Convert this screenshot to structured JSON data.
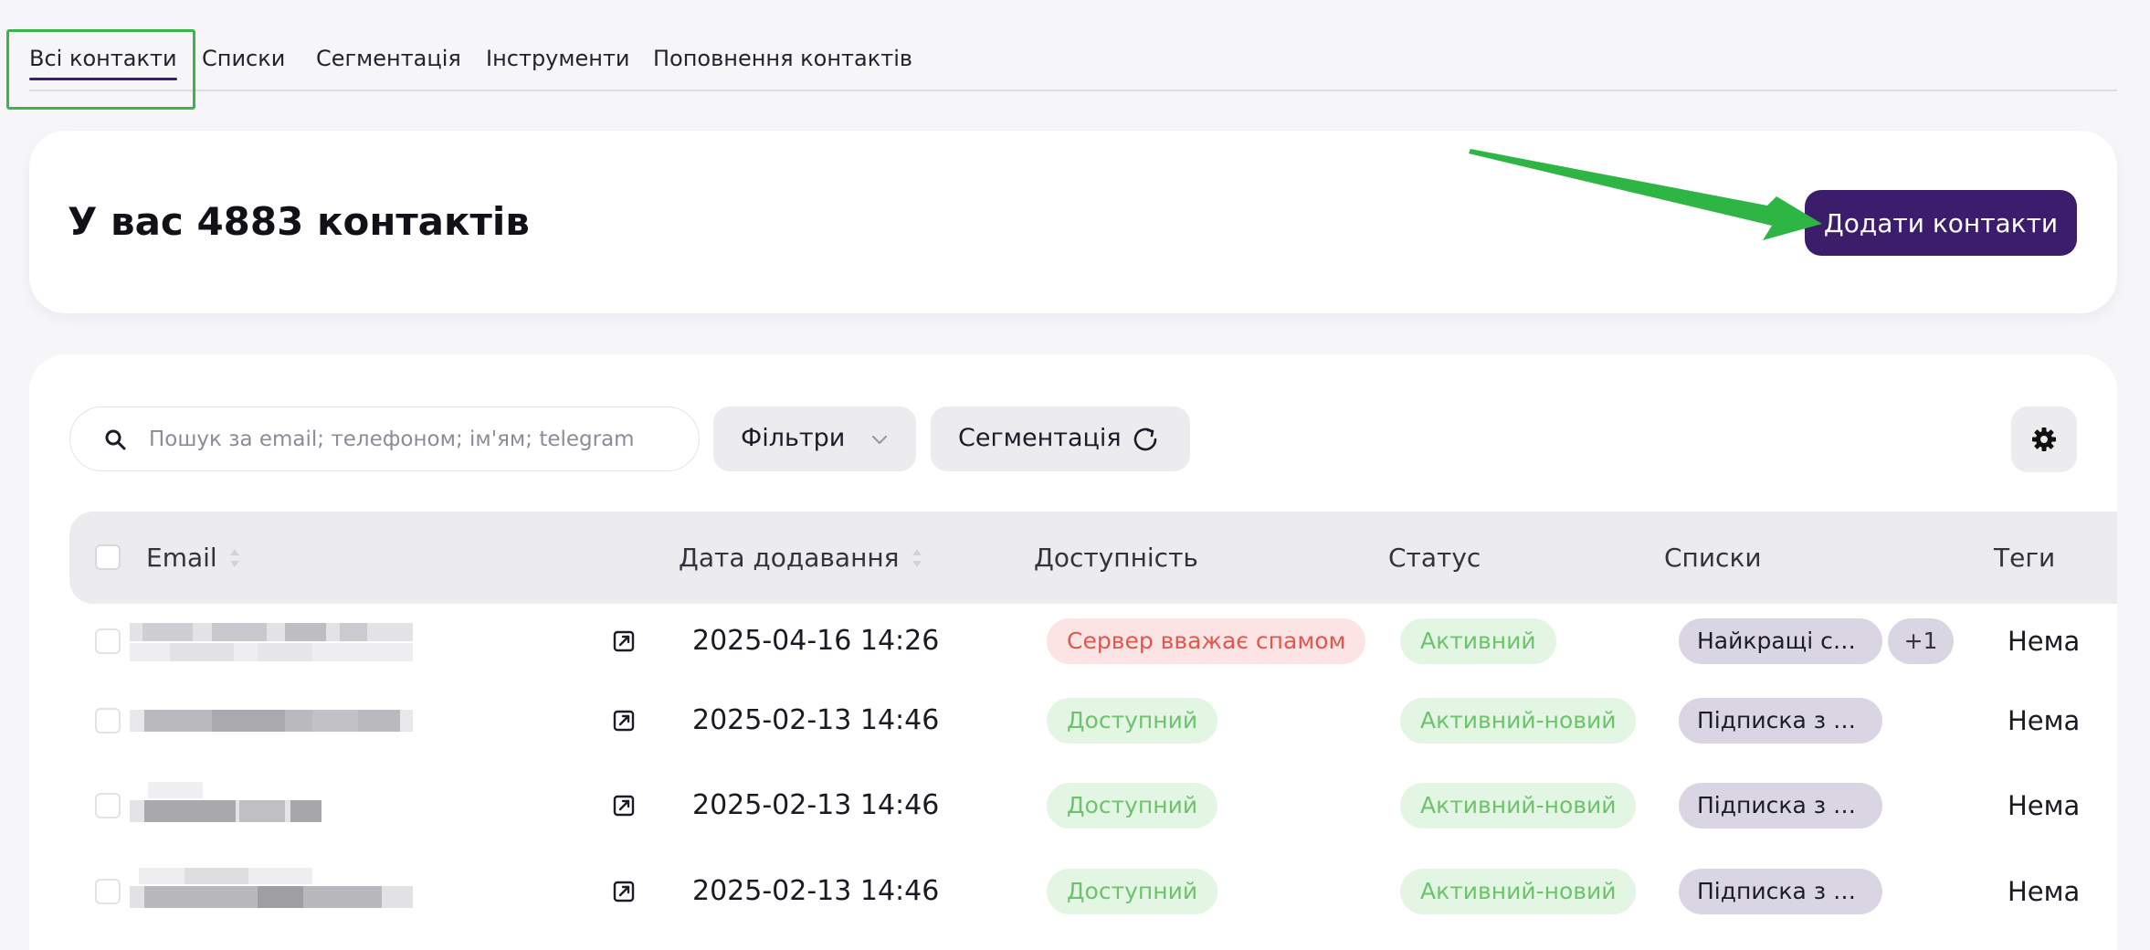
{
  "tabs": [
    {
      "label": "Всі контакти",
      "active": true
    },
    {
      "label": "Списки"
    },
    {
      "label": "Сегментація"
    },
    {
      "label": "Інструменти"
    },
    {
      "label": "Поповнення контактів"
    }
  ],
  "summary": {
    "title": "У вас 4883 контактів",
    "add_button": "Додати контакти"
  },
  "toolbar": {
    "search_placeholder": "Пошук за email; телефоном; ім'ям; telegram",
    "filters_label": "Фільтри",
    "segmentation_label": "Сегментація"
  },
  "table": {
    "headers": {
      "email": "Email",
      "date_added": "Дата додавання",
      "availability": "Доступність",
      "status": "Статус",
      "lists": "Списки",
      "tags": "Теги"
    },
    "rows": [
      {
        "date": "2025-04-16 14:26",
        "availability": "Сервер вважає спамом",
        "status": "Активний",
        "list": "Найкращі ст...",
        "more": "+1",
        "tags": "Нема"
      },
      {
        "date": "2025-02-13 14:46",
        "availability": "Доступний",
        "status": "Активний-новий",
        "list": "Підписка з ф...",
        "tags": "Нема"
      },
      {
        "date": "2025-02-13 14:46",
        "availability": "Доступний",
        "status": "Активний-новий",
        "list": "Підписка з ф...",
        "tags": "Нема"
      },
      {
        "date": "2025-02-13 14:46",
        "availability": "Доступний",
        "status": "Активний-новий",
        "list": "Підписка з ф...",
        "tags": "Нема"
      }
    ]
  },
  "colors": {
    "brand": "#3b1d6b",
    "highlight": "#3bb54a",
    "danger_text": "#e2574c",
    "success_text": "#6cc36c"
  },
  "icons": [
    "search-icon",
    "chevron-down-icon",
    "refresh-icon",
    "gear-icon",
    "sort-icon",
    "external-link-icon"
  ]
}
